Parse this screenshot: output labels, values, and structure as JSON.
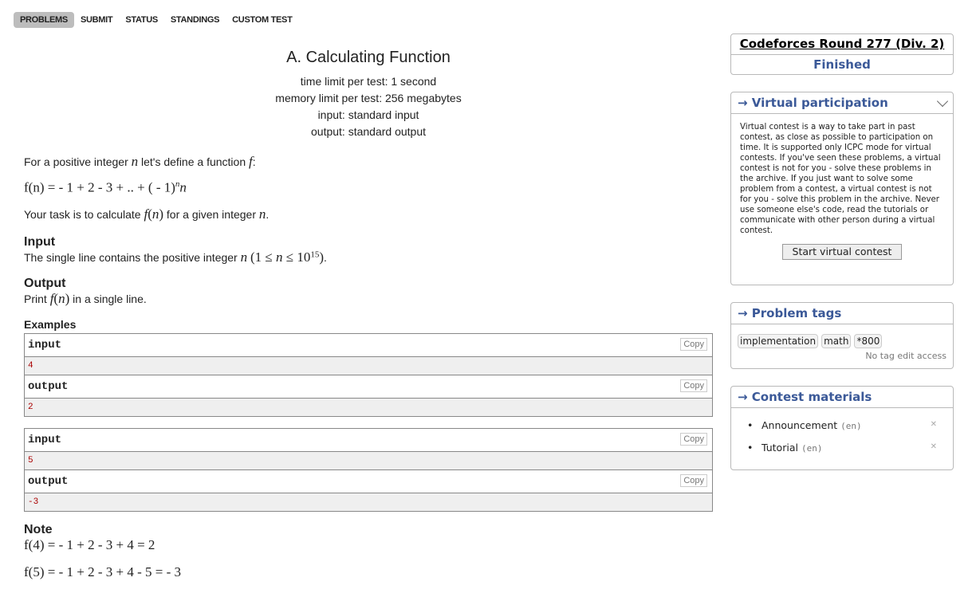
{
  "nav": [
    "PROBLEMS",
    "SUBMIT",
    "STATUS",
    "STANDINGS",
    "CUSTOM TEST"
  ],
  "problem": {
    "title": "A. Calculating Function",
    "time_limit": "time limit per test: 1 second",
    "memory_limit": "memory limit per test: 256 megabytes",
    "input": "input: standard input",
    "output": "output: standard output",
    "statement_1": "For a positive integer",
    "statement_1b": "let's define a function",
    "formula": "f(n) = - 1 + 2 - 3 + .. + ( - 1)",
    "task_a": "Your task is to calculate",
    "task_b": "for a given integer",
    "input_title": "Input",
    "input_text": "The single line contains the positive integer",
    "output_title": "Output",
    "output_a": "Print",
    "output_b": "in a single line.",
    "examples_title": "Examples",
    "note_title": "Note",
    "note_1": "f(4) = - 1 + 2 - 3 + 4 = 2",
    "note_2": "f(5) = - 1 + 2 - 3 + 4 - 5 = - 3"
  },
  "samples": {
    "input_label": "input",
    "output_label": "output",
    "copy_label": "Copy",
    "s1_in": "4",
    "s1_out": "2",
    "s2_in": "5",
    "s2_out": "-3"
  },
  "sidebar": {
    "contest_name": "Codeforces Round 277 (Div. 2)",
    "contest_status": "Finished",
    "virtual_title": "→ Virtual participation",
    "virtual_text": "Virtual contest is a way to take part in past contest, as close as possible to participation on time. It is supported only ICPC mode for virtual contests. If you've seen these problems, a virtual contest is not for you - solve these problems in the archive. If you just want to solve some problem from a contest, a virtual contest is not for you - solve this problem in the archive. Never use someone else's code, read the tutorials or communicate with other person during a virtual contest.",
    "virtual_button": "Start virtual contest",
    "tags_title": "→ Problem tags",
    "tags": [
      "implementation",
      "math",
      "*800"
    ],
    "no_tag_edit": "No tag edit access",
    "materials_title": "→ Contest materials",
    "materials": [
      {
        "name": "Announcement",
        "lang": "(en)"
      },
      {
        "name": "Tutorial",
        "lang": "(en)"
      }
    ]
  }
}
